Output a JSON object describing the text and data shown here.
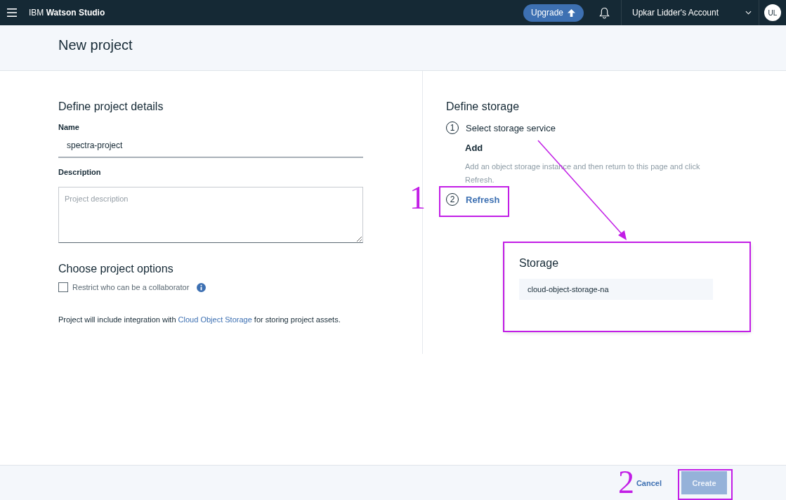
{
  "header": {
    "product_prefix": "IBM",
    "product_name": "Watson Studio",
    "upgrade_label": "Upgrade",
    "account": "Upkar Lidder's Account",
    "avatar": "UL"
  },
  "page_title": "New project",
  "details": {
    "heading": "Define project details",
    "name_label": "Name",
    "name_value": "spectra-project",
    "description_label": "Description",
    "description_placeholder": "Project description"
  },
  "options": {
    "heading": "Choose project options",
    "restrict_label": "Restrict who can be a collaborator",
    "restrict_checked": false,
    "note_before": "Project will include integration with",
    "note_link": "Cloud Object Storage",
    "note_after": "for storing project assets."
  },
  "storage": {
    "heading": "Define storage",
    "steps": [
      {
        "number": "1",
        "kind": "text",
        "label": "Select storage service"
      },
      {
        "number": "2",
        "kind": "link",
        "label": "Refresh"
      }
    ],
    "add_heading": "Add",
    "add_text": "Add an object storage instance and then return to this page and click Refresh.",
    "panel_title": "Storage",
    "instance": "cloud-object-storage-na"
  },
  "footer": {
    "cancel": "Cancel",
    "create": "Create",
    "create_disabled": true
  },
  "annotations": [
    {
      "text": "1"
    },
    {
      "text": "2"
    }
  ]
}
